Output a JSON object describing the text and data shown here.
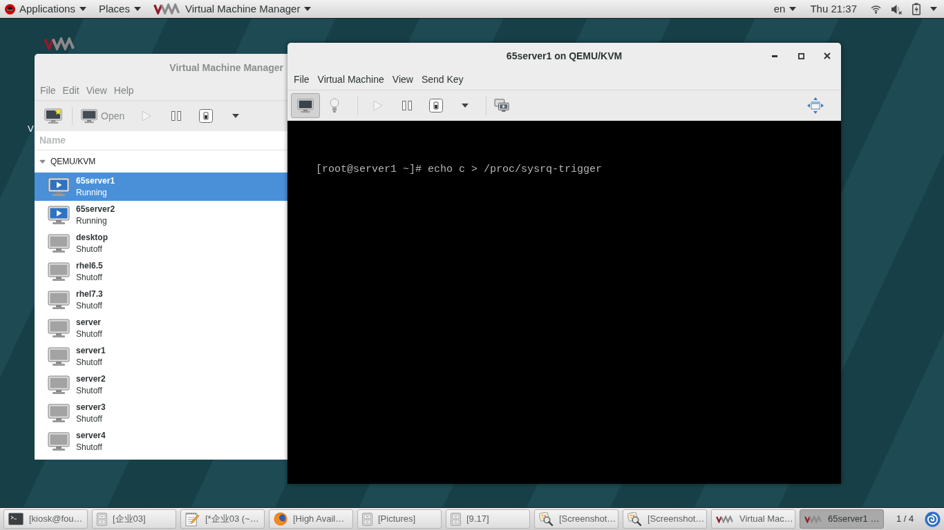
{
  "top_bar": {
    "menus": [
      {
        "kind": "applications",
        "label": "Applications"
      },
      {
        "kind": "places",
        "label": "Places"
      },
      {
        "kind": "app",
        "label": "Virtual Machine Manager"
      }
    ],
    "language": "en",
    "clock": "Thu 21:37"
  },
  "desktop": {
    "icon_label": "V"
  },
  "manager_window": {
    "title": "Virtual Machine Manager",
    "menu": [
      "File",
      "Edit",
      "View",
      "Help"
    ],
    "toolbar": [
      {
        "kind": "new",
        "disabled": false
      },
      {
        "kind": "open",
        "label": "Open",
        "disabled": false
      },
      {
        "kind": "run",
        "disabled": true
      },
      {
        "kind": "pause",
        "disabled": false
      },
      {
        "kind": "shutdown",
        "disabled": false
      },
      {
        "kind": "menu",
        "disabled": false
      }
    ],
    "list": {
      "column": "Name",
      "groups": [
        {
          "name": "QEMU/KVM",
          "expanded": true,
          "vms": [
            {
              "name": "65server1",
              "status": "Running",
              "kind": "running",
              "selected": true
            },
            {
              "name": "65server2",
              "status": "Running",
              "kind": "running",
              "selected": false
            },
            {
              "name": "desktop",
              "status": "Shutoff",
              "kind": "shutoff",
              "selected": false
            },
            {
              "name": "rhel6.5",
              "status": "Shutoff",
              "kind": "shutoff",
              "selected": false
            },
            {
              "name": "rhel7.3",
              "status": "Shutoff",
              "kind": "shutoff",
              "selected": false
            },
            {
              "name": "server",
              "status": "Shutoff",
              "kind": "shutoff",
              "selected": false
            },
            {
              "name": "server1",
              "status": "Shutoff",
              "kind": "shutoff",
              "selected": false
            },
            {
              "name": "server2",
              "status": "Shutoff",
              "kind": "shutoff",
              "selected": false
            },
            {
              "name": "server3",
              "status": "Shutoff",
              "kind": "shutoff",
              "selected": false
            },
            {
              "name": "server4",
              "status": "Shutoff",
              "kind": "shutoff",
              "selected": false
            }
          ]
        }
      ]
    }
  },
  "console_window": {
    "title": "65server1 on QEMU/KVM",
    "menu": [
      "File",
      "Virtual Machine",
      "View",
      "Send Key"
    ],
    "view_toggle": [
      {
        "kind": "console",
        "selected": true
      },
      {
        "kind": "details",
        "selected": false
      }
    ],
    "actions": [
      {
        "kind": "run",
        "disabled": true
      },
      {
        "kind": "pause",
        "disabled": false
      },
      {
        "kind": "shutdown",
        "disabled": false
      },
      {
        "kind": "menu",
        "disabled": false
      },
      {
        "kind": "snapshots",
        "disabled": false
      },
      {
        "kind": "fullscreen",
        "disabled": false
      }
    ],
    "console_lines": [
      "[root@server1 ~]# echo c > /proc/sysrq-trigger"
    ]
  },
  "taskbar": {
    "windows": [
      {
        "kind": "terminal",
        "label": "[kiosk@fou…",
        "selected": false
      },
      {
        "kind": "files",
        "label": "[企业03]",
        "selected": false
      },
      {
        "kind": "editor",
        "label": "[*企业03 (~…",
        "selected": false
      },
      {
        "kind": "browser",
        "label": "[High Avail…",
        "selected": false
      },
      {
        "kind": "files",
        "label": "[Pictures]",
        "selected": false
      },
      {
        "kind": "files",
        "label": "[9.17]",
        "selected": false
      },
      {
        "kind": "screenshot",
        "label": "[Screenshot…",
        "selected": false
      },
      {
        "kind": "screenshot",
        "label": "[Screenshot…",
        "selected": false
      },
      {
        "kind": "vmm",
        "label": "Virtual Mac…",
        "selected": false
      },
      {
        "kind": "vmm",
        "label": "65server1 …",
        "selected": true
      }
    ],
    "pager": "1 / 4"
  }
}
